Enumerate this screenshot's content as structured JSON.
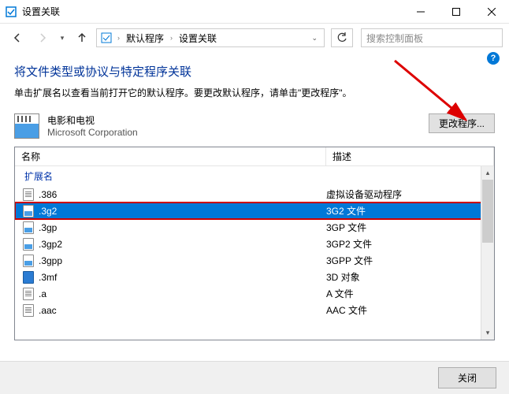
{
  "window": {
    "title": "设置关联"
  },
  "breadcrumb": {
    "items": [
      "默认程序",
      "设置关联"
    ]
  },
  "search": {
    "placeholder": "搜索控制面板"
  },
  "page": {
    "title": "将文件类型或协议与特定程序关联",
    "desc": "单击扩展名以查看当前打开它的默认程序。要更改默认程序，请单击\"更改程序\"。"
  },
  "app": {
    "name": "电影和电视",
    "vendor": "Microsoft Corporation"
  },
  "buttons": {
    "change": "更改程序...",
    "close": "关闭"
  },
  "list": {
    "col_name": "名称",
    "col_desc": "描述",
    "group": "扩展名",
    "rows": [
      {
        "ext": ".386",
        "desc": "虚拟设备驱动程序",
        "icon": "doc"
      },
      {
        "ext": ".3g2",
        "desc": "3G2 文件",
        "icon": "video",
        "selected": true
      },
      {
        "ext": ".3gp",
        "desc": "3GP 文件",
        "icon": "video"
      },
      {
        "ext": ".3gp2",
        "desc": "3GP2 文件",
        "icon": "video"
      },
      {
        "ext": ".3gpp",
        "desc": "3GPP 文件",
        "icon": "video"
      },
      {
        "ext": ".3mf",
        "desc": "3D 对象",
        "icon": "blue"
      },
      {
        "ext": ".a",
        "desc": "A 文件",
        "icon": "doc"
      },
      {
        "ext": ".aac",
        "desc": "AAC 文件",
        "icon": "doc"
      }
    ]
  }
}
